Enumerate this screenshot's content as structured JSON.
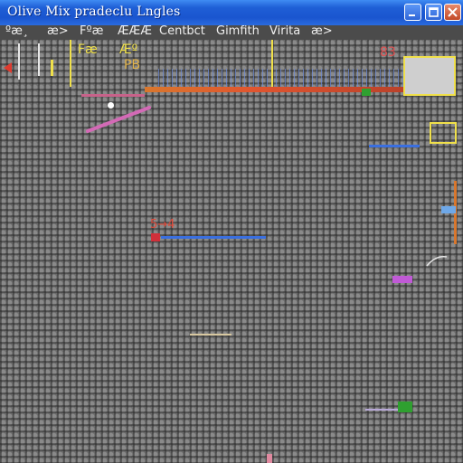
{
  "window": {
    "title": "Olive Mix pradeclu Lngles"
  },
  "menu": {
    "items": [
      {
        "label": "ºæ¸",
        "tone": "normal"
      },
      {
        "label": "æ>",
        "tone": "normal"
      },
      {
        "label": "Fºæ",
        "tone": "normal"
      },
      {
        "label": "ÆÆÆ",
        "tone": "normal"
      },
      {
        "label": "Centbct",
        "tone": "normal"
      },
      {
        "label": "Gimfith",
        "tone": "normal"
      },
      {
        "label": "Virita",
        "tone": "normal"
      },
      {
        "label": "æ>",
        "tone": "normal"
      }
    ]
  },
  "canvas": {
    "labels": {
      "fb": "Fæ",
      "fib": "Æº",
      "pb": "PB",
      "num": "5→4",
      "corner": "83"
    }
  },
  "colors": {
    "titlebar": "#1f5fd6",
    "menu_text": "#eeeeee",
    "accent_yellow": "#f0e04a",
    "accent_orange": "#d9772d",
    "line_blue": "#3a6fe0",
    "line_pink": "#d46ab6",
    "marker_red": "#d0303a",
    "marker_green": "#2fa030"
  },
  "icons": [
    "minimize-icon",
    "maximize-icon",
    "close-icon",
    "back-arrow-icon"
  ]
}
